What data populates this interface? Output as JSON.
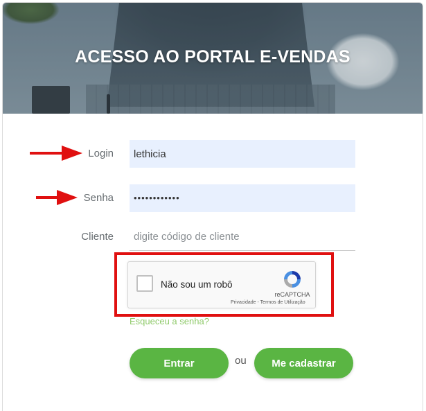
{
  "header": {
    "title": "ACESSO AO PORTAL E-VENDAS"
  },
  "form": {
    "login": {
      "label": "Login",
      "value": "lethicia"
    },
    "senha": {
      "label": "Senha",
      "value": "••••••••••••"
    },
    "cliente": {
      "label": "Cliente",
      "value": "",
      "placeholder": "digite código de cliente"
    },
    "forgot_link": "Esqueceu a senha?"
  },
  "recaptcha": {
    "checkbox_label": "Não sou um robô",
    "brand": "reCAPTCHA",
    "links": "Privacidade - Termos de Utilização",
    "checked": false
  },
  "actions": {
    "enter_label": "Entrar",
    "separator": "ou",
    "register_label": "Me cadastrar"
  },
  "colors": {
    "accent_green": "#5ab543",
    "annotation_red": "#e01010",
    "autofill_bg": "#e8f0fe"
  },
  "icons": {
    "arrows": [
      "arrow-right-icon",
      "arrow-right-icon"
    ],
    "recaptcha_logo": "recaptcha-logo-icon"
  }
}
